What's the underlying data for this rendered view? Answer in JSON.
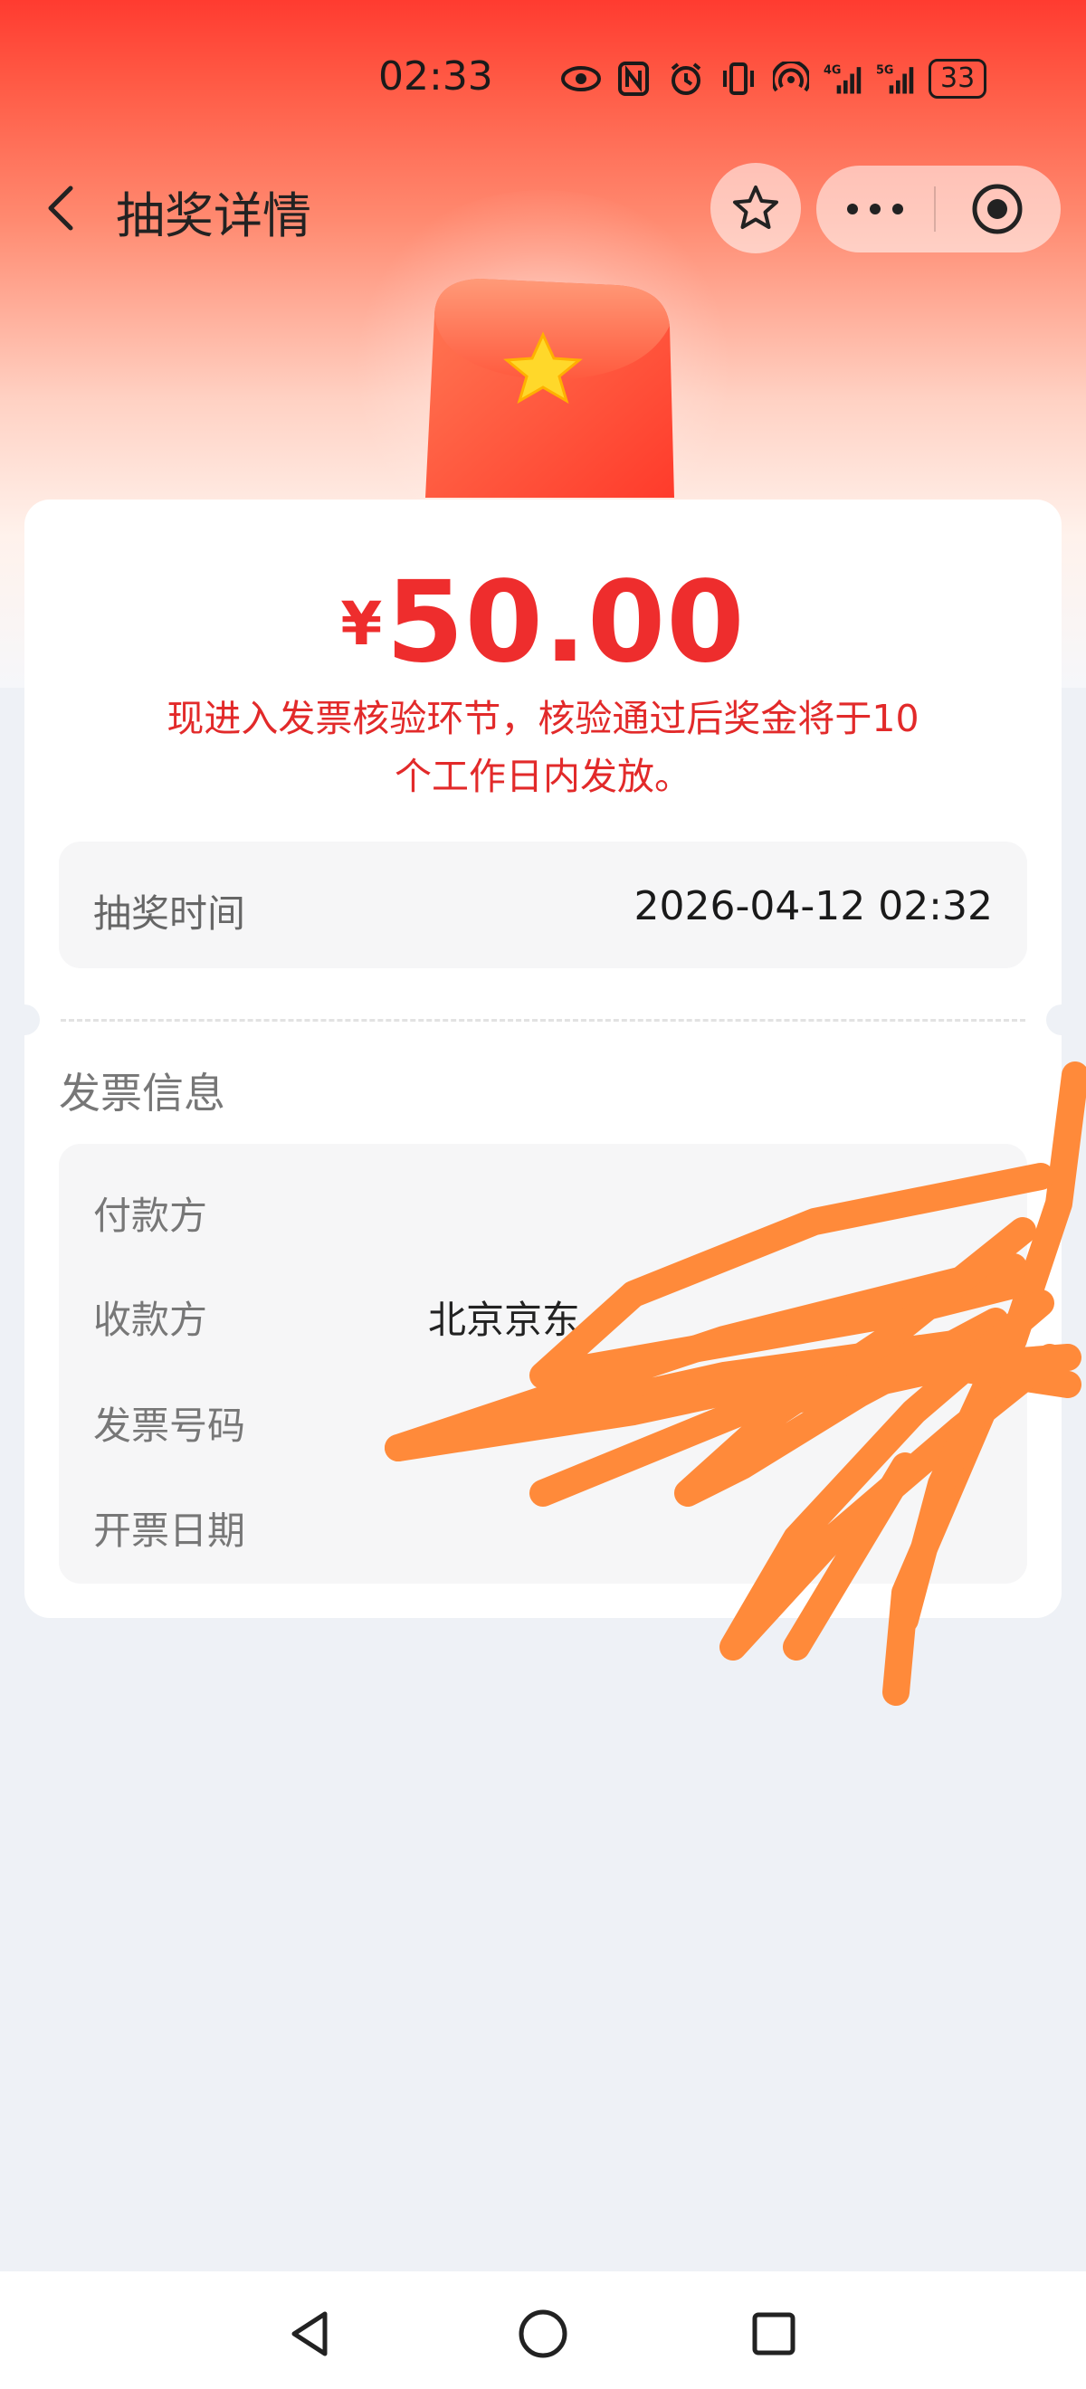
{
  "status_bar": {
    "time": "02:33",
    "signal_1": "4G",
    "signal_2": "5G",
    "battery": "33",
    "icons": [
      "eye-icon",
      "nfc-icon",
      "alarm-icon",
      "vibrate-icon",
      "hotspot-icon",
      "signal-icon",
      "signal-icon",
      "battery-icon"
    ]
  },
  "header": {
    "title": "抽奖详情",
    "icons": [
      "back-arrow-icon",
      "star-icon",
      "more-dots-icon",
      "target-close-icon"
    ]
  },
  "prize": {
    "currency": "¥",
    "amount": "50.00",
    "notice_line1": "现进入发票核验环节，核验通过后奖金将于10",
    "notice_line2": "个工作日内发放。"
  },
  "draw_time": {
    "label": "抽奖时间",
    "value": "2026-04-12 02:32"
  },
  "invoice": {
    "heading": "发票信息",
    "rows": [
      {
        "label": "付款方",
        "value": ""
      },
      {
        "label": "收款方",
        "value": "北京京东"
      },
      {
        "label": "发票号码",
        "value": ""
      },
      {
        "label": "开票日期",
        "value": ""
      }
    ]
  },
  "system_nav": {
    "icons": [
      "back-triangle-icon",
      "home-circle-icon",
      "recents-square-icon"
    ]
  },
  "colors": {
    "accent_red": "#ee2d2d",
    "scribble_orange": "#ff8a3a"
  }
}
